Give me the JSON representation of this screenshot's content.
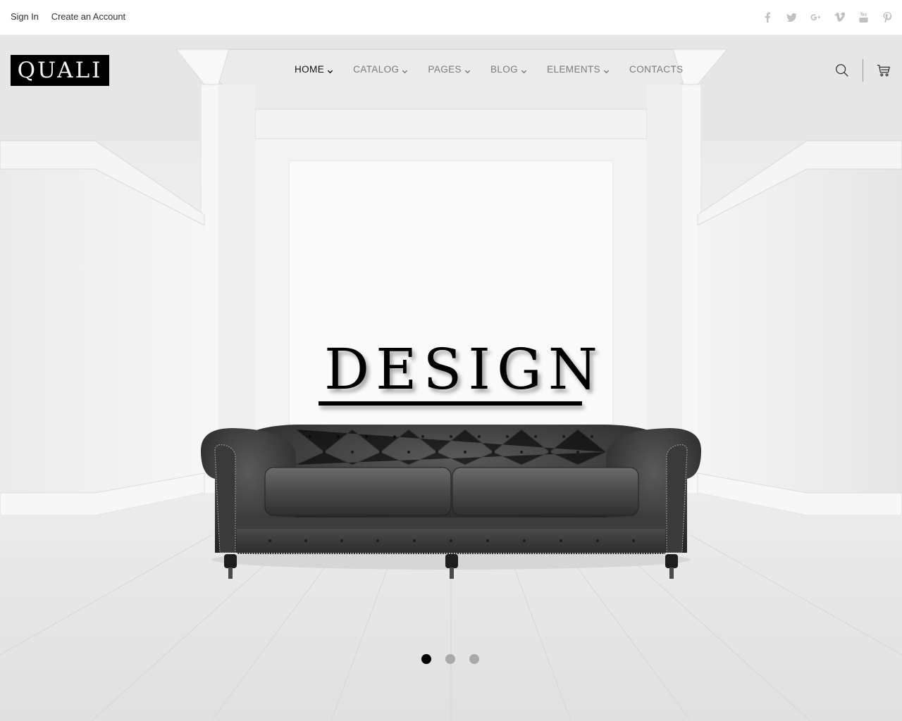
{
  "topbar": {
    "sign_in": "Sign In",
    "create_account": "Create an Account",
    "social": [
      "facebook",
      "twitter",
      "google-plus",
      "vimeo",
      "youtube",
      "pinterest"
    ]
  },
  "header": {
    "logo": "QUALI",
    "nav": [
      {
        "label": "HOME",
        "dropdown": true,
        "active": true
      },
      {
        "label": "CATALOG",
        "dropdown": true,
        "active": false
      },
      {
        "label": "PAGES",
        "dropdown": true,
        "active": false
      },
      {
        "label": "BLOG",
        "dropdown": true,
        "active": false
      },
      {
        "label": "ELEMENTS",
        "dropdown": true,
        "active": false
      },
      {
        "label": "CONTACTS",
        "dropdown": false,
        "active": false
      }
    ],
    "icons": [
      "search-icon",
      "cart-icon"
    ]
  },
  "hero": {
    "headline": "DESIGN",
    "image": "black tufted chesterfield leather sofa in white room",
    "slides": {
      "count": 3,
      "active": 1
    }
  },
  "colors": {
    "nav_active": "#111111",
    "nav_inactive": "#7a7a7a",
    "logo_bg": "#000000",
    "dot_active": "#000000",
    "dot_inactive": "#a9a9a9",
    "social_icon": "#c0c0c0"
  }
}
